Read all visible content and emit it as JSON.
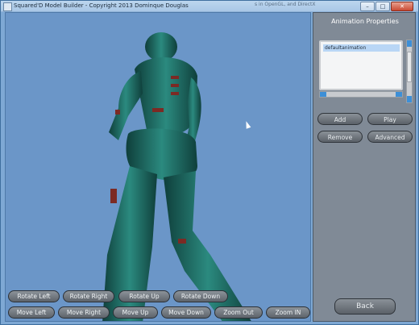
{
  "window": {
    "title": "Squared'D Model Builder - Copyright 2013 Dominque Douglas",
    "background_tab_text": "s in OpenGL, and DirectX"
  },
  "colors": {
    "viewport_bg": "#6b96c8",
    "panel_bg": "#808a96",
    "model_teal": "#1f6c64",
    "button_fill": "#70777e"
  },
  "panel": {
    "title": "Animation Properties",
    "list_items": [
      "defaultanimation"
    ],
    "buttons": {
      "add": "Add",
      "play": "Play",
      "remove": "Remove",
      "advanced": "Advanced",
      "back": "Back"
    }
  },
  "toolbar": {
    "rotate_left": "Rotate Left",
    "rotate_right": "Rotate Right",
    "rotate_up": "Rotate Up",
    "rotate_down": "Rotate Down",
    "move_left": "Move Left",
    "move_right": "Move Right",
    "move_up": "Move Up",
    "move_down": "Move Down",
    "zoom_out": "Zoom Out",
    "zoom_in": "Zoom IN"
  }
}
